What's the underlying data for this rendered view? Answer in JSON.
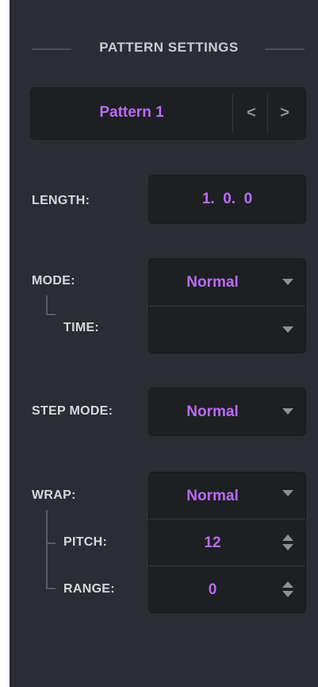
{
  "header": {
    "title": "PATTERN SETTINGS"
  },
  "pattern": {
    "name": "Pattern 1",
    "prev_symbol": "<",
    "next_symbol": ">"
  },
  "length": {
    "label": "LENGTH:",
    "value": "1.  0.  0"
  },
  "mode": {
    "label": "MODE:",
    "value": "Normal",
    "time_label": "TIME:",
    "time_value": ""
  },
  "step_mode": {
    "label": "STEP MODE:",
    "value": "Normal"
  },
  "wrap": {
    "label": "WRAP:",
    "value": "Normal",
    "pitch_label": "PITCH:",
    "pitch_value": "12",
    "range_label": "RANGE:",
    "range_value": "0"
  },
  "colors": {
    "panel_bg": "#2a2d31",
    "field_bg": "#1d1f22",
    "accent": "#b86cf2",
    "label": "#d6d8dc"
  }
}
